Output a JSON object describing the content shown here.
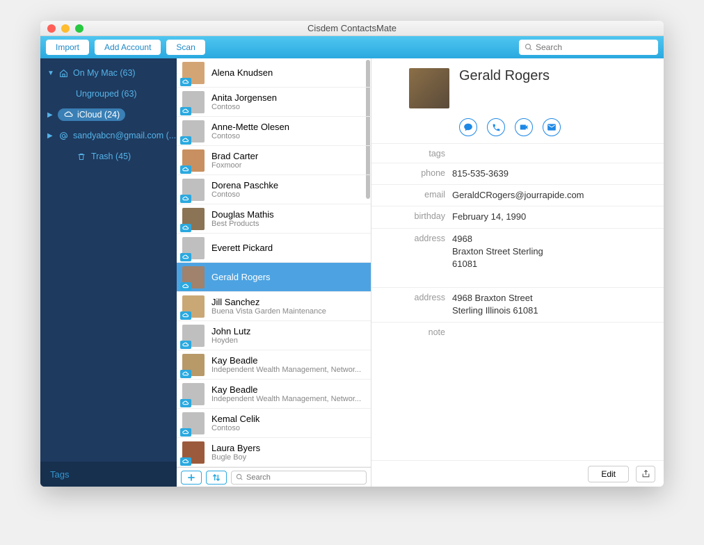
{
  "window": {
    "title": "Cisdem ContactsMate"
  },
  "toolbar": {
    "import": "Import",
    "add_account": "Add Account",
    "scan": "Scan",
    "search_placeholder": "Search"
  },
  "sidebar": {
    "items": [
      {
        "label": "On My Mac (63)",
        "icon": "home",
        "disclosure": "▼",
        "indent": 0
      },
      {
        "label": "Ungrouped (63)",
        "icon": "",
        "disclosure": "",
        "indent": 1
      },
      {
        "label": "iCloud (24)",
        "icon": "cloud",
        "disclosure": "▶",
        "indent": 0,
        "pill": true
      },
      {
        "label": "sandyabcn@gmail.com (...",
        "icon": "at",
        "disclosure": "▶",
        "indent": 0
      },
      {
        "label": "Trash (45)",
        "icon": "trash",
        "disclosure": "",
        "indent": 1
      }
    ],
    "tags_label": "Tags"
  },
  "contacts": [
    {
      "name": "Alena Knudsen",
      "sub": ""
    },
    {
      "name": "Anita Jorgensen",
      "sub": "Contoso"
    },
    {
      "name": "Anne-Mette Olesen",
      "sub": "Contoso"
    },
    {
      "name": "Brad Carter",
      "sub": "Foxmoor"
    },
    {
      "name": "Dorena Paschke",
      "sub": "Contoso"
    },
    {
      "name": "Douglas Mathis",
      "sub": "Best Products"
    },
    {
      "name": "Everett Pickard",
      "sub": ""
    },
    {
      "name": "Gerald Rogers",
      "sub": "",
      "selected": true
    },
    {
      "name": "Jill Sanchez",
      "sub": "Buena Vista Garden Maintenance"
    },
    {
      "name": "John Lutz",
      "sub": "Hoyden"
    },
    {
      "name": "Kay Beadle",
      "sub": "Independent Wealth Management, Networ..."
    },
    {
      "name": "Kay Beadle",
      "sub": "Independent Wealth Management, Networ..."
    },
    {
      "name": "Kemal Celik",
      "sub": "Contoso"
    },
    {
      "name": "Laura Byers",
      "sub": "Bugle Boy"
    }
  ],
  "list_footer": {
    "search_placeholder": "Search"
  },
  "detail": {
    "name": "Gerald Rogers",
    "fields": [
      {
        "label": "tags",
        "value": ""
      },
      {
        "label": "phone",
        "value": "815-535-3639"
      },
      {
        "label": "email",
        "value": "GeraldCRogers@jourrapide.com"
      },
      {
        "label": "birthday",
        "value": "February 14, 1990"
      },
      {
        "label": "address",
        "value": "4968\nBraxton Street Sterling\n61081"
      },
      {
        "label": "address",
        "value": "4968 Braxton Street\nSterling Illinois 61081"
      },
      {
        "label": "note",
        "value": ""
      }
    ],
    "edit": "Edit"
  }
}
